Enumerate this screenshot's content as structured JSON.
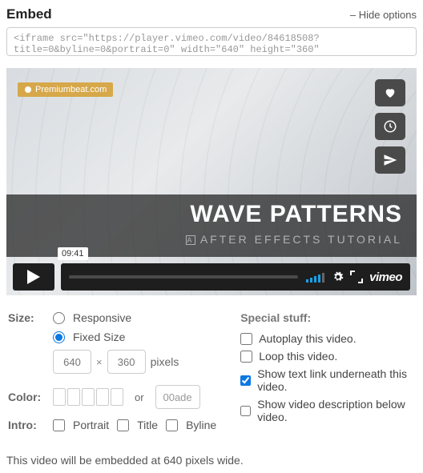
{
  "header": {
    "title": "Embed",
    "hide": "– Hide options"
  },
  "embed_code": "<iframe src=\"https://player.vimeo.com/video/84618508?title=0&byline=0&portrait=0\" width=\"640\" height=\"360\"",
  "player": {
    "badge": "Premiumbeat.com",
    "title": "WAVE PATTERNS",
    "subtitle": "AFTER EFFECTS TUTORIAL",
    "duration": "09:41",
    "logo": "vimeo"
  },
  "options": {
    "size_label": "Size:",
    "responsive": "Responsive",
    "fixed": "Fixed Size",
    "width": "640",
    "height": "360",
    "pixels": "pixels",
    "times": "×",
    "color_label": "Color:",
    "or": "or",
    "color_value": "00ade",
    "intro_label": "Intro:",
    "portrait": "Portrait",
    "title": "Title",
    "byline": "Byline",
    "special": "Special stuff:",
    "autoplay": "Autoplay this video.",
    "loop": "Loop this video.",
    "textlink": "Show text link underneath this video.",
    "description": "Show video description below video."
  },
  "footer": "This video will be embedded at 640 pixels wide."
}
